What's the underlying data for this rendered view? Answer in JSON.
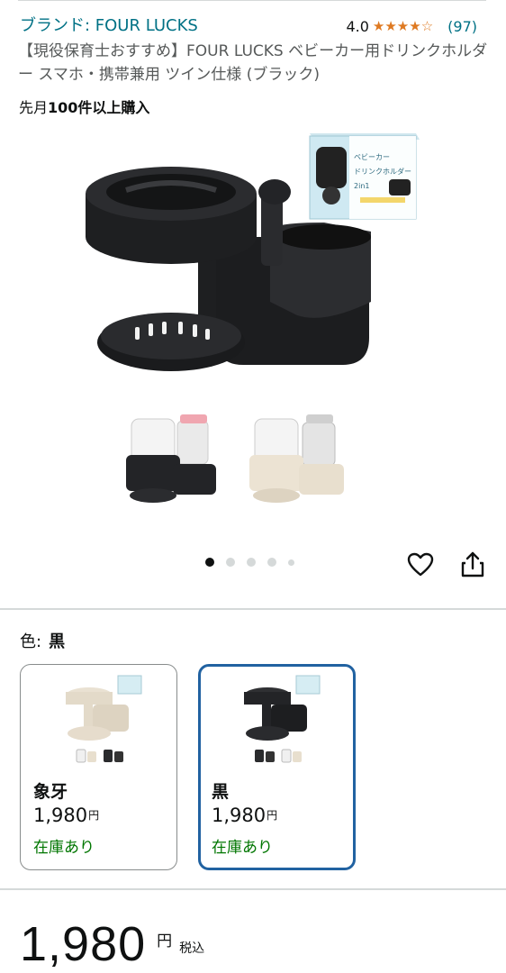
{
  "brand": {
    "label": "ブランド: FOUR LUCKS"
  },
  "rating": {
    "value": "4.0",
    "stars_filled": 4,
    "stars_total": 5,
    "review_count": "(97)",
    "star_color": "#de7921"
  },
  "title": "【現役保育士おすすめ】FOUR LUCKS ベビーカー用ドリンクホルダー スマホ・携帯兼用 ツイン仕様 (ブラック)",
  "bought": {
    "prefix": "先月",
    "bold": "100件以上購入"
  },
  "gallery": {
    "box_text": [
      "ベビーカー",
      "ドリンクホルダー",
      "2in1"
    ],
    "carousel_count": 5,
    "active_index": 0
  },
  "actions": {
    "favorite_icon": "heart-icon",
    "share_icon": "share-icon"
  },
  "color_selector": {
    "label": "色:",
    "selected": "黒",
    "options": [
      {
        "name": "象牙",
        "price": "1,980",
        "currency": "円",
        "stock": "在庫あり",
        "product_color": "#e8e0d0"
      },
      {
        "name": "黒",
        "price": "1,980",
        "currency": "円",
        "stock": "在庫あり",
        "product_color": "#2a2b2d"
      }
    ]
  },
  "price": {
    "amount": "1,980",
    "currency": "円",
    "tax": "税込"
  },
  "colors": {
    "link": "#007185",
    "stock": "#007600",
    "selected_border": "#2162a1",
    "divider": "#d5d9d9"
  }
}
